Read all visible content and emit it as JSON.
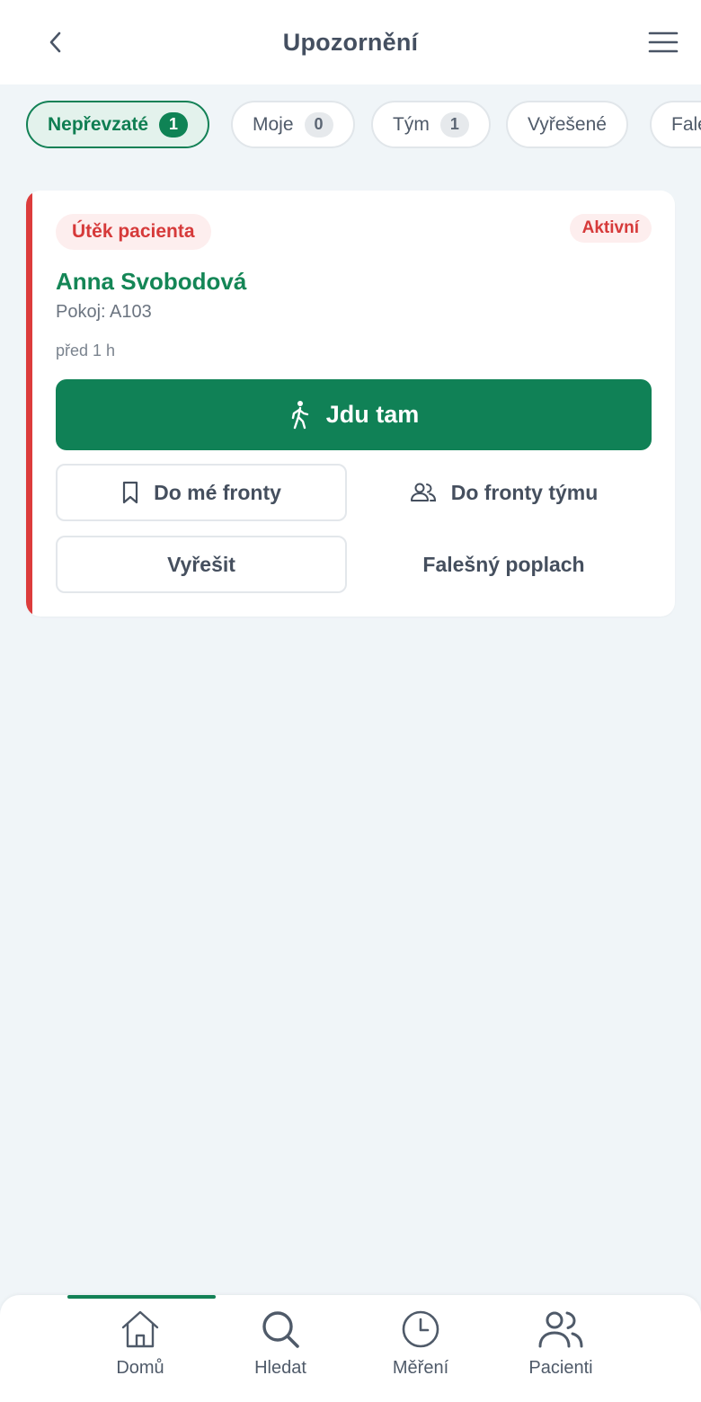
{
  "header": {
    "title": "Upozornění"
  },
  "tabs": [
    {
      "label": "Nepřevzaté",
      "count": "1"
    },
    {
      "label": "Moje",
      "count": "0"
    },
    {
      "label": "Tým",
      "count": "1"
    },
    {
      "label": "Vyřešené",
      "count": ""
    },
    {
      "label": "Falešné",
      "count": ""
    }
  ],
  "alert": {
    "type": "Útěk pacienta",
    "status": "Aktivní",
    "patient_name": "Anna Svobodová",
    "room": "Pokoj: A103",
    "time": "před 1 h",
    "primary_action": "Jdu tam",
    "my_queue_label": "Do mé fronty",
    "team_queue_label": "Do fronty týmu",
    "resolve_label": "Vyřešit",
    "false_alarm_label": "Falešný poplach",
    "accent_color": "#dc3c3c"
  },
  "bottom_nav": {
    "items": [
      {
        "label": "Domů",
        "icon": "home-icon"
      },
      {
        "label": "Hledat",
        "icon": "search-icon"
      },
      {
        "label": "Měření",
        "icon": "clock-icon"
      },
      {
        "label": "Pacienti",
        "icon": "users-icon"
      }
    ],
    "active_index": 0
  },
  "colors": {
    "brand_green": "#108156",
    "alert_red": "#d63a3a",
    "background": "#f0f5f8"
  }
}
